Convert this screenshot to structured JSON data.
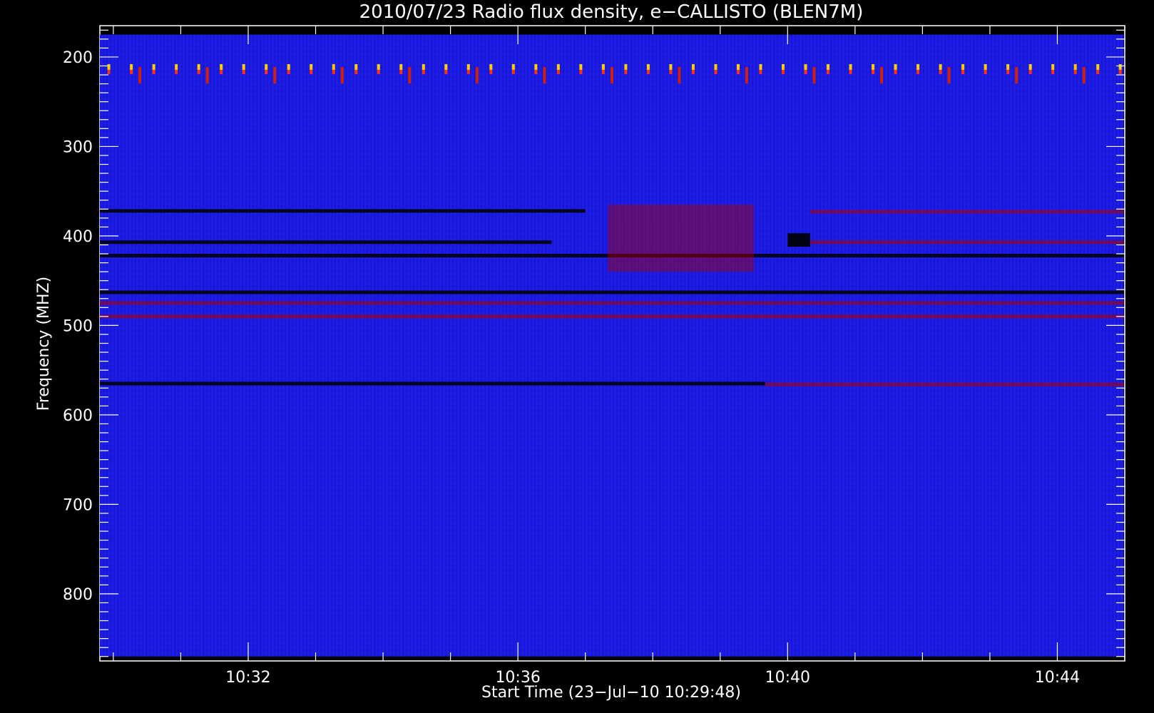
{
  "chart_data": {
    "type": "heatmap",
    "title": "2010/07/23  Radio flux density, e−CALLISTO (BLEN7M)",
    "xlabel": "Start Time (23−Jul−10 10:29:48)",
    "ylabel": "Frequency (MHZ)",
    "x_unit": "time (HH:MM)",
    "y_unit": "MHz",
    "xlim": [
      "10:29:48",
      "10:45:00"
    ],
    "ylim": [
      875,
      165
    ],
    "data_extent": {
      "x": [
        "10:29:48",
        "10:44:59"
      ],
      "y": [
        175,
        870
      ]
    },
    "y_inverted": true,
    "x_ticks": [
      "10:32",
      "10:36",
      "10:40",
      "10:44"
    ],
    "y_ticks": [
      200,
      300,
      400,
      500,
      600,
      700,
      800
    ],
    "colorscale": {
      "low": "#000000",
      "background": "#1a1ae6",
      "mid": "#aa0000",
      "high": "#ffffff",
      "hot": "#ffd000"
    },
    "features": [
      {
        "name": "periodic bursts near 210-225 MHz",
        "y_range": [
          208,
          228
        ],
        "x_range": [
          "10:29:48",
          "10:44:59"
        ],
        "intensity": "high",
        "period_s": 20
      },
      {
        "name": "dark band 372 MHz",
        "y": 372,
        "x_range": [
          "10:29:48",
          "10:37:00"
        ],
        "intensity": "low"
      },
      {
        "name": "dark band 407 MHz",
        "y": 407,
        "x_range": [
          "10:29:48",
          "10:36:30"
        ],
        "intensity": "low"
      },
      {
        "name": "dark band 422 MHz",
        "y": 422,
        "x_range": [
          "10:29:48",
          "10:44:59"
        ],
        "intensity": "low"
      },
      {
        "name": "dark band 463 MHz",
        "y": 463,
        "x_range": [
          "10:29:48",
          "10:44:59"
        ],
        "intensity": "low"
      },
      {
        "name": "red band 475 MHz",
        "y": 475,
        "x_range": [
          "10:29:48",
          "10:44:59"
        ],
        "intensity": "mid"
      },
      {
        "name": "band 490 MHz",
        "y": 490,
        "x_range": [
          "10:29:48",
          "10:44:59"
        ],
        "intensity": "mid"
      },
      {
        "name": "dark band 565 MHz",
        "y": 565,
        "x_range": [
          "10:29:48",
          "10:39:40"
        ],
        "intensity": "low"
      },
      {
        "name": "red band 566 MHz",
        "y": 566,
        "x_range": [
          "10:39:40",
          "10:44:59"
        ],
        "intensity": "mid"
      },
      {
        "name": "red patch 370-440 MHz",
        "y_range": [
          365,
          440
        ],
        "x_range": [
          "10:37:20",
          "10:39:30"
        ],
        "intensity": "mid"
      },
      {
        "name": "red band 373 MHz",
        "y": 373,
        "x_range": [
          "10:40:20",
          "10:44:59"
        ],
        "intensity": "mid"
      },
      {
        "name": "red band 407 MHz",
        "y": 407,
        "x_range": [
          "10:40:20",
          "10:44:59"
        ],
        "intensity": "mid"
      },
      {
        "name": "dark block 400-410 MHz",
        "y_range": [
          397,
          412
        ],
        "x_range": [
          "10:40:00",
          "10:40:20"
        ],
        "intensity": "low"
      }
    ]
  }
}
